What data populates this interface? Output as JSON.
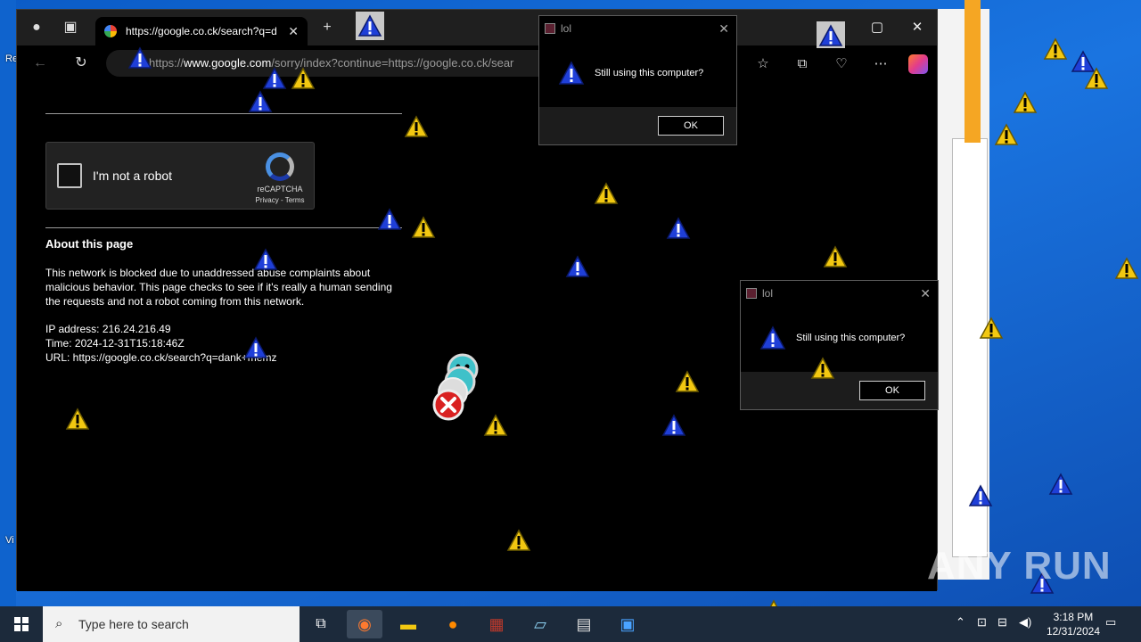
{
  "browser": {
    "tab_title": "https://google.co.ck/search?q=d",
    "url_prefix": "https://",
    "url_host": "www.google.com",
    "url_rest": "/sorry/index?continue=https://google.co.ck/sear"
  },
  "recaptcha": {
    "label": "I'm not a robot",
    "brand": "reCAPTCHA",
    "links": "Privacy - Terms"
  },
  "page": {
    "about_title": "About this page",
    "about_body": "This network is blocked due to unaddressed abuse complaints about malicious behavior. This page checks to see if it's really a human sending the requests and not a robot coming from this network.",
    "ip_line": "IP address: 216.24.216.49",
    "time_line": "Time: 2024-12-31T15:18:46Z",
    "url_line": "URL: https://google.co.ck/search?q=dank+memz"
  },
  "dialogs": [
    {
      "title": "lol",
      "message": "Still using this computer?",
      "ok": "OK"
    },
    {
      "title": "lol",
      "message": "Still using this computer?",
      "ok": "OK"
    }
  ],
  "taskbar": {
    "search_placeholder": "Type here to search",
    "time": "3:18 PM",
    "date": "12/31/2024"
  },
  "watermark": "ANY RUN",
  "colors": {
    "warning_yellow": "#f2c811",
    "info_blue": "#1f3fd8",
    "desktop_blue": "#1668d6",
    "taskbar": "#1c2a3b"
  }
}
